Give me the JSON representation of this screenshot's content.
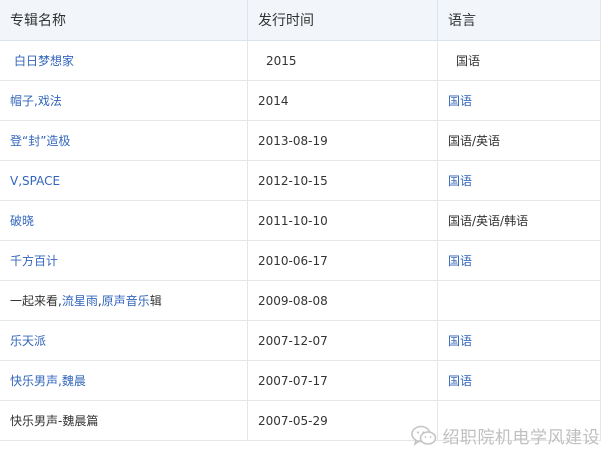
{
  "columns": [
    "专辑名称",
    "发行时间",
    "语言"
  ],
  "rows": [
    {
      "album": [
        {
          "text": "白日梦想家",
          "link": true
        }
      ],
      "date": "2015",
      "lang": [
        {
          "text": "国语",
          "link": false
        }
      ],
      "indent": true
    },
    {
      "album": [
        {
          "text": "帽子,戏法",
          "link": true
        }
      ],
      "date": "2014",
      "lang": [
        {
          "text": "国语",
          "link": true
        }
      ]
    },
    {
      "album": [
        {
          "text": "登“封”造极",
          "link": true
        }
      ],
      "date": "2013-08-19",
      "lang": [
        {
          "text": "国语/英语",
          "link": false
        }
      ]
    },
    {
      "album": [
        {
          "text": "V,SPACE",
          "link": true
        }
      ],
      "date": "2012-10-15",
      "lang": [
        {
          "text": "国语",
          "link": true
        }
      ]
    },
    {
      "album": [
        {
          "text": "破晓",
          "link": true
        }
      ],
      "date": "2011-10-10",
      "lang": [
        {
          "text": "国语/英语/韩语",
          "link": false
        }
      ]
    },
    {
      "album": [
        {
          "text": "千方百计",
          "link": true
        }
      ],
      "date": "2010-06-17",
      "lang": [
        {
          "text": "国语",
          "link": true
        }
      ]
    },
    {
      "album": [
        {
          "text": "一起来看,",
          "link": false
        },
        {
          "text": "流星雨",
          "link": true
        },
        {
          "text": ",",
          "link": false
        },
        {
          "text": "原声音乐",
          "link": true
        },
        {
          "text": "辑",
          "link": false
        }
      ],
      "date": "2009-08-08",
      "lang": []
    },
    {
      "album": [
        {
          "text": "乐天派",
          "link": true
        }
      ],
      "date": "2007-12-07",
      "lang": [
        {
          "text": "国语",
          "link": true
        }
      ]
    },
    {
      "album": [
        {
          "text": "快乐男声,",
          "link": true
        },
        {
          "text": "魏晨",
          "link": true
        }
      ],
      "date": "2007-07-17",
      "lang": [
        {
          "text": "国语",
          "link": true
        }
      ]
    },
    {
      "album": [
        {
          "text": "快乐男声-魏晨篇",
          "link": false
        }
      ],
      "date": "2007-05-29",
      "lang": []
    }
  ],
  "watermark": {
    "text": "绍职院机电学风建设",
    "icon": "wechat-icon"
  },
  "colors": {
    "link": "#3366bb",
    "text": "#333333",
    "header_bg": "#f2f6fb",
    "border": "#e6e6e6",
    "watermark": "#bfbfbf"
  }
}
